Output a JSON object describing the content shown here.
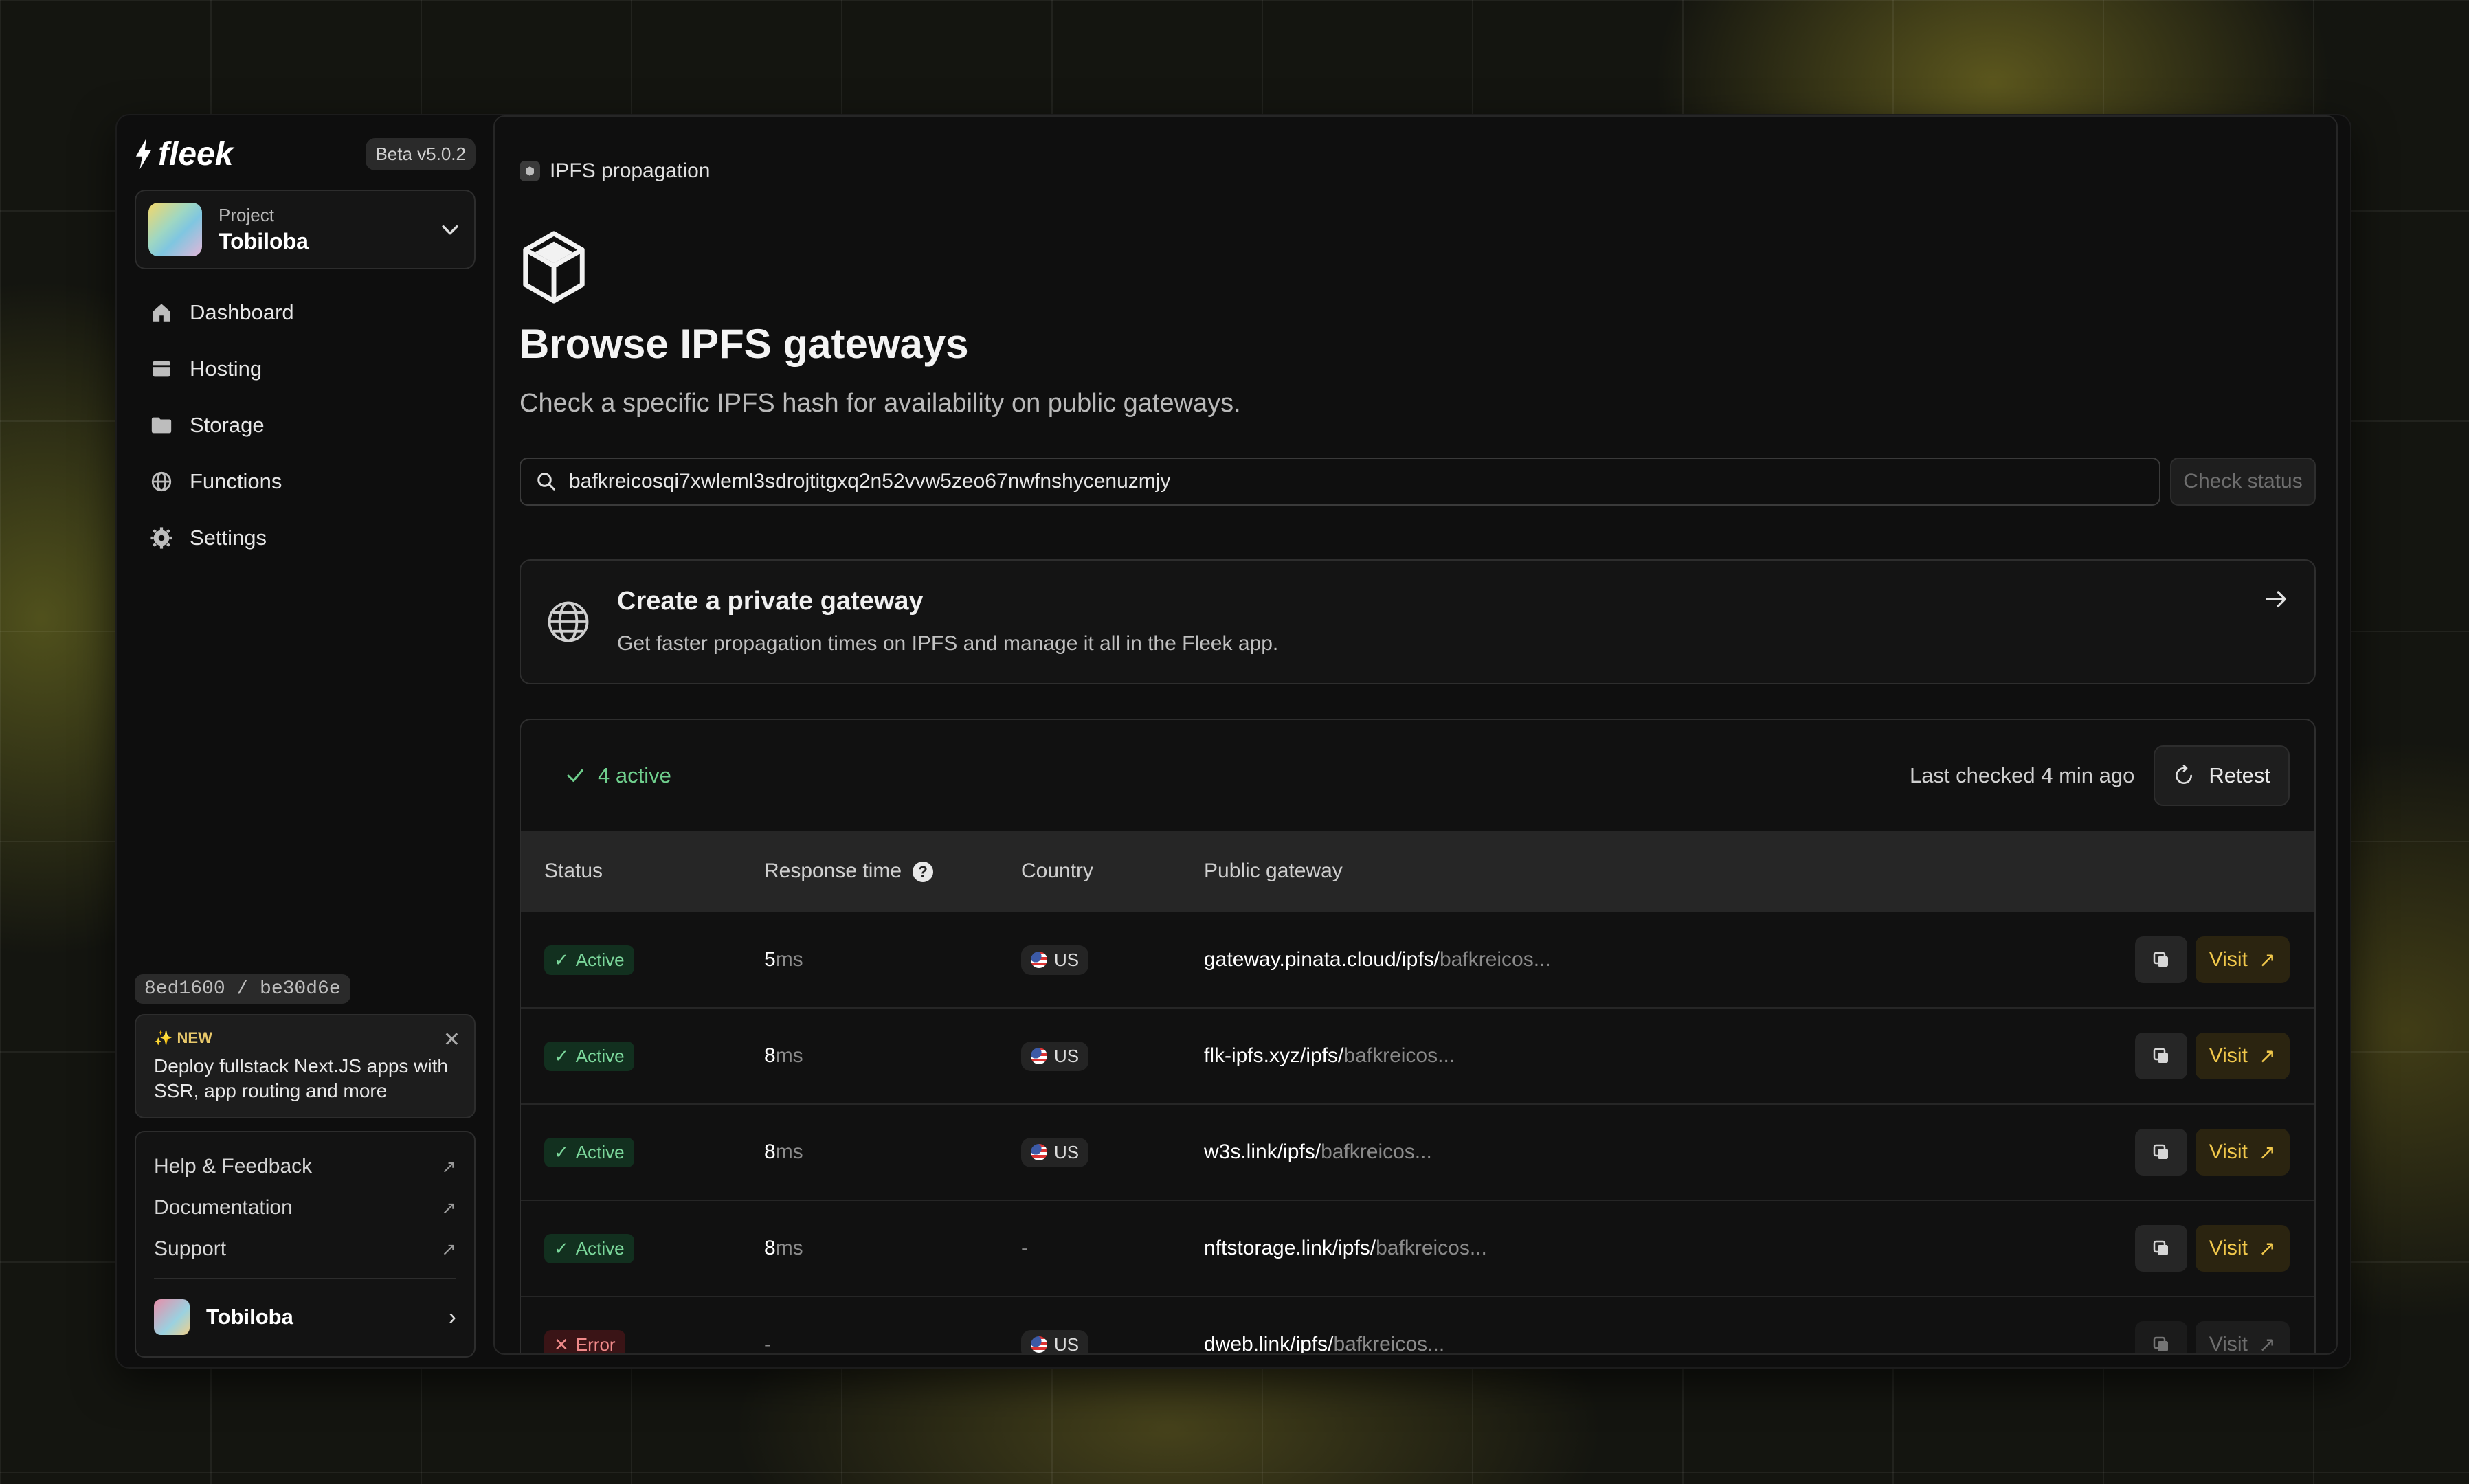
{
  "brand": {
    "name": "fleek",
    "version": "Beta v5.0.2"
  },
  "project": {
    "label": "Project",
    "name": "Tobiloba"
  },
  "nav": [
    {
      "label": "Dashboard",
      "icon": "home-icon"
    },
    {
      "label": "Hosting",
      "icon": "hosting-icon"
    },
    {
      "label": "Storage",
      "icon": "folder-icon"
    },
    {
      "label": "Functions",
      "icon": "globe-icon"
    },
    {
      "label": "Settings",
      "icon": "gear-icon"
    }
  ],
  "commit": "8ed1600 / be30d6e",
  "promo": {
    "tag": "✨ NEW",
    "text": "Deploy fullstack Next.JS apps with SSR, app routing and more"
  },
  "links": [
    "Help & Feedback",
    "Documentation",
    "Support"
  ],
  "user": {
    "name": "Tobiloba"
  },
  "breadcrumb": "IPFS propagation",
  "page": {
    "title": "Browse IPFS gateways",
    "subtitle": "Check a specific IPFS hash for availability on public gateways."
  },
  "search": {
    "value": "bafkreicosqi7xwleml3sdrojtitgxq2n52vvw5zeo67nwfnshycenuzmjy",
    "button": "Check status"
  },
  "private_gateway": {
    "title": "Create a private gateway",
    "subtitle": "Get faster propagation times on IPFS and manage it all in the Fleek app."
  },
  "results": {
    "active_count": "4 active",
    "last_checked": "Last checked 4 min ago",
    "retest": "Retest",
    "columns": [
      "Status",
      "Response time",
      "Country",
      "Public gateway"
    ],
    "rows": [
      {
        "status": "Active",
        "ms": "5",
        "unit": "ms",
        "country": "US",
        "host": "gateway.pinata.cloud/ipfs/",
        "hash": "bafkreicos...",
        "visit": "Visit"
      },
      {
        "status": "Active",
        "ms": "8",
        "unit": "ms",
        "country": "US",
        "host": "flk-ipfs.xyz/ipfs/",
        "hash": "bafkreicos...",
        "visit": "Visit"
      },
      {
        "status": "Active",
        "ms": "8",
        "unit": "ms",
        "country": "US",
        "host": "w3s.link/ipfs/",
        "hash": "bafkreicos...",
        "visit": "Visit"
      },
      {
        "status": "Active",
        "ms": "8",
        "unit": "ms",
        "country": "-",
        "host": "nftstorage.link/ipfs/",
        "hash": "bafkreicos...",
        "visit": "Visit"
      },
      {
        "status": "Error",
        "ms": "-",
        "unit": "",
        "country": "US",
        "host": "dweb.link/ipfs/",
        "hash": "bafkreicos...",
        "visit": "Visit"
      }
    ]
  },
  "colors": {
    "accent": "#f1c84b",
    "success": "#7bd79b",
    "error": "#f08a8a"
  }
}
